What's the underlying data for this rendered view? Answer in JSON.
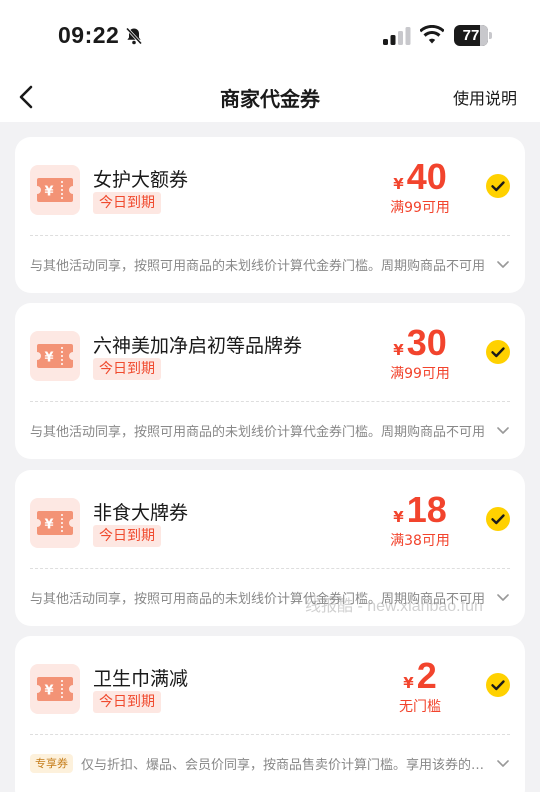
{
  "status_bar": {
    "time": "09:22",
    "battery_level": "77",
    "battery_fraction": 0.77
  },
  "nav": {
    "title": "商家代金券",
    "help_label": "使用说明"
  },
  "colors": {
    "accent": "#f2442d",
    "check": "#ffd100",
    "badge_bg": "#fde7e2"
  },
  "coupons": [
    {
      "name": "女护大额券",
      "badge": "今日到期",
      "currency": "¥",
      "amount": "40",
      "threshold": "满99可用",
      "rule": "与其他活动同享，按照可用商品的未划线价计算代金券门槛。周期购商品不可用",
      "selected": true
    },
    {
      "name": "六神美加净启初等品牌券",
      "badge": "今日到期",
      "currency": "¥",
      "amount": "30",
      "threshold": "满99可用",
      "rule": "与其他活动同享，按照可用商品的未划线价计算代金券门槛。周期购商品不可用",
      "selected": true
    },
    {
      "name": "非食大牌券",
      "badge": "今日到期",
      "currency": "¥",
      "amount": "18",
      "threshold": "满38可用",
      "rule": "与其他活动同享，按照可用商品的未划线价计算代金券门槛。周期购商品不可用",
      "selected": true
    },
    {
      "name": "卫生巾满减",
      "badge": "今日到期",
      "currency": "¥",
      "amount": "2",
      "threshold": "无门槛",
      "tag": "专享券",
      "rule": "仅与折扣、爆品、会员价同享，按商品售卖价计算门槛。享用该券的商品不可用",
      "selected": true
    }
  ],
  "watermark": "线报酷 - new.xianbao.fun"
}
